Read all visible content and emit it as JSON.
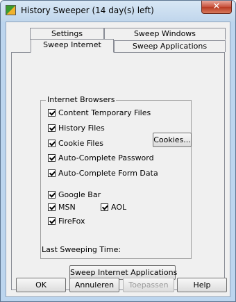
{
  "window": {
    "title": "History Sweeper (14 day(s) left)",
    "close_glyph": "✕"
  },
  "tabs": {
    "settings": "Settings",
    "sweep_windows": "Sweep Windows",
    "sweep_internet": "Sweep Internet",
    "sweep_applications": "Sweep Applications"
  },
  "browsers": {
    "group_title": "Internet Browsers",
    "items": [
      {
        "label": "Content Temporary Files",
        "checked": true
      },
      {
        "label": "History Files",
        "checked": true
      },
      {
        "label": "Cookie Files",
        "checked": true
      },
      {
        "label": "Auto-Complete Password",
        "checked": true
      },
      {
        "label": "Auto-Complete Form Data",
        "checked": true
      },
      {
        "label": "Google Bar",
        "checked": true
      },
      {
        "label": "MSN",
        "checked": true
      },
      {
        "label": "AOL",
        "checked": true
      },
      {
        "label": "FireFox",
        "checked": true
      }
    ],
    "cookies_button": "Cookies..."
  },
  "last_sweeping_label": "Last Sweeping Time:",
  "sweep_button": "Sweep Internet Applications",
  "footer": {
    "ok": "OK",
    "cancel": "Annuleren",
    "apply": "Toepassen",
    "help": "Help"
  }
}
